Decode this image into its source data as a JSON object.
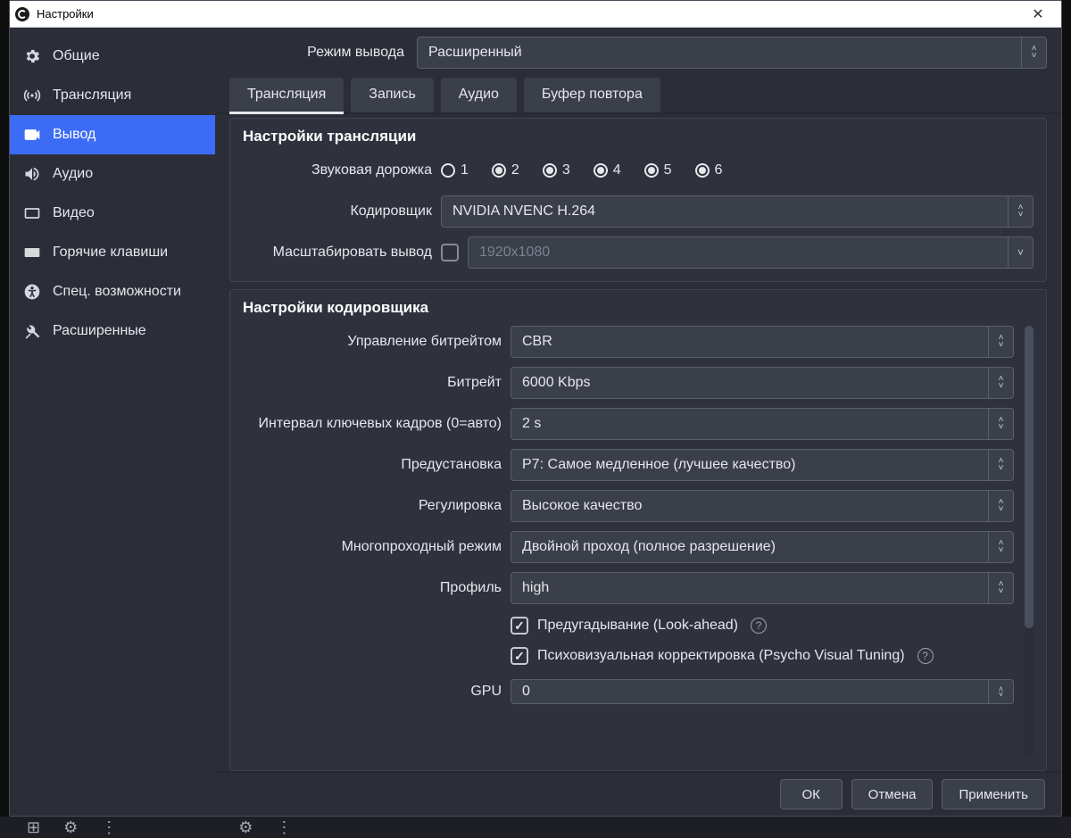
{
  "window": {
    "title": "Настройки"
  },
  "sidebar": {
    "items": [
      {
        "label": "Общие"
      },
      {
        "label": "Трансляция"
      },
      {
        "label": "Вывод"
      },
      {
        "label": "Аудио"
      },
      {
        "label": "Видео"
      },
      {
        "label": "Горячие клавиши"
      },
      {
        "label": "Спец. возможности"
      },
      {
        "label": "Расширенные"
      }
    ]
  },
  "output_mode": {
    "label": "Режим вывода",
    "value": "Расширенный"
  },
  "tabs": [
    {
      "label": "Трансляция"
    },
    {
      "label": "Запись"
    },
    {
      "label": "Аудио"
    },
    {
      "label": "Буфер повтора"
    }
  ],
  "stream_settings": {
    "title": "Настройки трансляции",
    "audio_track_label": "Звуковая дорожка",
    "tracks": [
      "1",
      "2",
      "3",
      "4",
      "5",
      "6"
    ],
    "selected_track": 1,
    "encoder_label": "Кодировщик",
    "encoder_value": "NVIDIA NVENC H.264",
    "rescale_label": "Масштабировать вывод",
    "rescale_checked": false,
    "rescale_placeholder": "1920x1080"
  },
  "encoder_settings": {
    "title": "Настройки кодировщика",
    "rate_control_label": "Управление битрейтом",
    "rate_control_value": "CBR",
    "bitrate_label": "Битрейт",
    "bitrate_value": "6000 Kbps",
    "keyint_label": "Интервал ключевых кадров (0=авто)",
    "keyint_value": "2 s",
    "preset_label": "Предустановка",
    "preset_value": "P7: Самое медленное (лучшее качество)",
    "tuning_label": "Регулировка",
    "tuning_value": "Высокое качество",
    "multipass_label": "Многопроходный режим",
    "multipass_value": "Двойной проход (полное разрешение)",
    "profile_label": "Профиль",
    "profile_value": "high",
    "lookahead_label": "Предугадывание (Look-ahead)",
    "lookahead_checked": true,
    "psycho_label": "Психовизуальная корректировка (Psycho Visual Tuning)",
    "psycho_checked": true,
    "gpu_label": "GPU",
    "gpu_value": "0"
  },
  "footer": {
    "ok": "ОК",
    "cancel": "Отмена",
    "apply": "Применить"
  }
}
